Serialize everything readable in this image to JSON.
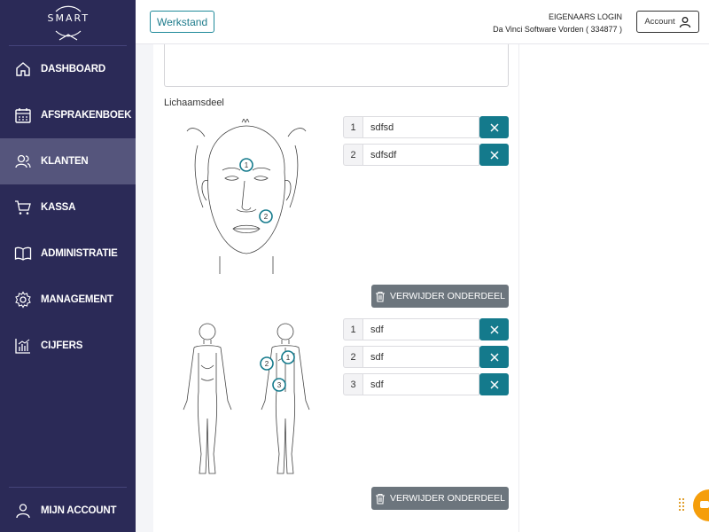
{
  "sidebar": {
    "logo": "SMART",
    "items": [
      {
        "label": "DASHBOARD",
        "icon": "home-icon"
      },
      {
        "label": "AFSPRAKENBOEK",
        "icon": "calendar-icon"
      },
      {
        "label": "KLANTEN",
        "icon": "users-icon"
      },
      {
        "label": "KASSA",
        "icon": "cart-icon"
      },
      {
        "label": "ADMINISTRATIE",
        "icon": "book-icon"
      },
      {
        "label": "MANAGEMENT",
        "icon": "gear-icon"
      },
      {
        "label": "CIJFERS",
        "icon": "chart-icon"
      }
    ],
    "account_label": "MIJN ACCOUNT"
  },
  "header": {
    "werkstand_label": "Werkstand",
    "owner_title": "EIGENAARS LOGIN",
    "owner_subtitle": "Da Vinci Software Vorden ( 334877 )",
    "account_label": "Account"
  },
  "main": {
    "section_label": "Lichaamsdeel",
    "face_diagram": {
      "markers": [
        "1",
        "2"
      ],
      "entries": [
        {
          "num": "1",
          "value": "sdfsd"
        },
        {
          "num": "2",
          "value": "sdfsdf"
        }
      ],
      "remove_label": "VERWIJDER ONDERDEEL"
    },
    "body_diagram": {
      "markers": [
        "1",
        "2",
        "3"
      ],
      "entries": [
        {
          "num": "1",
          "value": "sdf"
        },
        {
          "num": "2",
          "value": "sdf"
        },
        {
          "num": "3",
          "value": "sdf"
        }
      ],
      "remove_label": "VERWIJDER ONDERDEEL"
    }
  },
  "colors": {
    "sidebar": "#2b2a57",
    "sidebar_active": "#55557c",
    "accent": "#147a8c",
    "remove_button": "#6c757d"
  }
}
